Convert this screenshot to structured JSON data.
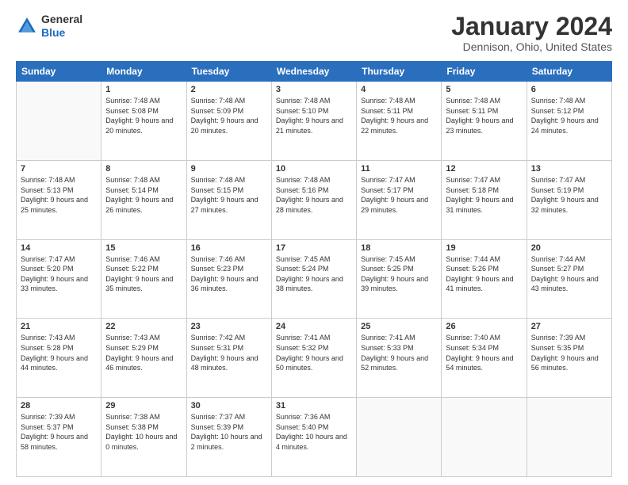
{
  "header": {
    "logo": {
      "line1": "General",
      "line2": "Blue"
    },
    "title": "January 2024",
    "subtitle": "Dennison, Ohio, United States"
  },
  "calendar": {
    "days_of_week": [
      "Sunday",
      "Monday",
      "Tuesday",
      "Wednesday",
      "Thursday",
      "Friday",
      "Saturday"
    ],
    "weeks": [
      [
        {
          "day": "",
          "sunrise": "",
          "sunset": "",
          "daylight": "",
          "empty": true
        },
        {
          "day": "1",
          "sunrise": "Sunrise: 7:48 AM",
          "sunset": "Sunset: 5:08 PM",
          "daylight": "Daylight: 9 hours and 20 minutes."
        },
        {
          "day": "2",
          "sunrise": "Sunrise: 7:48 AM",
          "sunset": "Sunset: 5:09 PM",
          "daylight": "Daylight: 9 hours and 20 minutes."
        },
        {
          "day": "3",
          "sunrise": "Sunrise: 7:48 AM",
          "sunset": "Sunset: 5:10 PM",
          "daylight": "Daylight: 9 hours and 21 minutes."
        },
        {
          "day": "4",
          "sunrise": "Sunrise: 7:48 AM",
          "sunset": "Sunset: 5:11 PM",
          "daylight": "Daylight: 9 hours and 22 minutes."
        },
        {
          "day": "5",
          "sunrise": "Sunrise: 7:48 AM",
          "sunset": "Sunset: 5:11 PM",
          "daylight": "Daylight: 9 hours and 23 minutes."
        },
        {
          "day": "6",
          "sunrise": "Sunrise: 7:48 AM",
          "sunset": "Sunset: 5:12 PM",
          "daylight": "Daylight: 9 hours and 24 minutes."
        }
      ],
      [
        {
          "day": "7",
          "sunrise": "Sunrise: 7:48 AM",
          "sunset": "Sunset: 5:13 PM",
          "daylight": "Daylight: 9 hours and 25 minutes."
        },
        {
          "day": "8",
          "sunrise": "Sunrise: 7:48 AM",
          "sunset": "Sunset: 5:14 PM",
          "daylight": "Daylight: 9 hours and 26 minutes."
        },
        {
          "day": "9",
          "sunrise": "Sunrise: 7:48 AM",
          "sunset": "Sunset: 5:15 PM",
          "daylight": "Daylight: 9 hours and 27 minutes."
        },
        {
          "day": "10",
          "sunrise": "Sunrise: 7:48 AM",
          "sunset": "Sunset: 5:16 PM",
          "daylight": "Daylight: 9 hours and 28 minutes."
        },
        {
          "day": "11",
          "sunrise": "Sunrise: 7:47 AM",
          "sunset": "Sunset: 5:17 PM",
          "daylight": "Daylight: 9 hours and 29 minutes."
        },
        {
          "day": "12",
          "sunrise": "Sunrise: 7:47 AM",
          "sunset": "Sunset: 5:18 PM",
          "daylight": "Daylight: 9 hours and 31 minutes."
        },
        {
          "day": "13",
          "sunrise": "Sunrise: 7:47 AM",
          "sunset": "Sunset: 5:19 PM",
          "daylight": "Daylight: 9 hours and 32 minutes."
        }
      ],
      [
        {
          "day": "14",
          "sunrise": "Sunrise: 7:47 AM",
          "sunset": "Sunset: 5:20 PM",
          "daylight": "Daylight: 9 hours and 33 minutes."
        },
        {
          "day": "15",
          "sunrise": "Sunrise: 7:46 AM",
          "sunset": "Sunset: 5:22 PM",
          "daylight": "Daylight: 9 hours and 35 minutes."
        },
        {
          "day": "16",
          "sunrise": "Sunrise: 7:46 AM",
          "sunset": "Sunset: 5:23 PM",
          "daylight": "Daylight: 9 hours and 36 minutes."
        },
        {
          "day": "17",
          "sunrise": "Sunrise: 7:45 AM",
          "sunset": "Sunset: 5:24 PM",
          "daylight": "Daylight: 9 hours and 38 minutes."
        },
        {
          "day": "18",
          "sunrise": "Sunrise: 7:45 AM",
          "sunset": "Sunset: 5:25 PM",
          "daylight": "Daylight: 9 hours and 39 minutes."
        },
        {
          "day": "19",
          "sunrise": "Sunrise: 7:44 AM",
          "sunset": "Sunset: 5:26 PM",
          "daylight": "Daylight: 9 hours and 41 minutes."
        },
        {
          "day": "20",
          "sunrise": "Sunrise: 7:44 AM",
          "sunset": "Sunset: 5:27 PM",
          "daylight": "Daylight: 9 hours and 43 minutes."
        }
      ],
      [
        {
          "day": "21",
          "sunrise": "Sunrise: 7:43 AM",
          "sunset": "Sunset: 5:28 PM",
          "daylight": "Daylight: 9 hours and 44 minutes."
        },
        {
          "day": "22",
          "sunrise": "Sunrise: 7:43 AM",
          "sunset": "Sunset: 5:29 PM",
          "daylight": "Daylight: 9 hours and 46 minutes."
        },
        {
          "day": "23",
          "sunrise": "Sunrise: 7:42 AM",
          "sunset": "Sunset: 5:31 PM",
          "daylight": "Daylight: 9 hours and 48 minutes."
        },
        {
          "day": "24",
          "sunrise": "Sunrise: 7:41 AM",
          "sunset": "Sunset: 5:32 PM",
          "daylight": "Daylight: 9 hours and 50 minutes."
        },
        {
          "day": "25",
          "sunrise": "Sunrise: 7:41 AM",
          "sunset": "Sunset: 5:33 PM",
          "daylight": "Daylight: 9 hours and 52 minutes."
        },
        {
          "day": "26",
          "sunrise": "Sunrise: 7:40 AM",
          "sunset": "Sunset: 5:34 PM",
          "daylight": "Daylight: 9 hours and 54 minutes."
        },
        {
          "day": "27",
          "sunrise": "Sunrise: 7:39 AM",
          "sunset": "Sunset: 5:35 PM",
          "daylight": "Daylight: 9 hours and 56 minutes."
        }
      ],
      [
        {
          "day": "28",
          "sunrise": "Sunrise: 7:39 AM",
          "sunset": "Sunset: 5:37 PM",
          "daylight": "Daylight: 9 hours and 58 minutes."
        },
        {
          "day": "29",
          "sunrise": "Sunrise: 7:38 AM",
          "sunset": "Sunset: 5:38 PM",
          "daylight": "Daylight: 10 hours and 0 minutes."
        },
        {
          "day": "30",
          "sunrise": "Sunrise: 7:37 AM",
          "sunset": "Sunset: 5:39 PM",
          "daylight": "Daylight: 10 hours and 2 minutes."
        },
        {
          "day": "31",
          "sunrise": "Sunrise: 7:36 AM",
          "sunset": "Sunset: 5:40 PM",
          "daylight": "Daylight: 10 hours and 4 minutes."
        },
        {
          "day": "",
          "sunrise": "",
          "sunset": "",
          "daylight": "",
          "empty": true
        },
        {
          "day": "",
          "sunrise": "",
          "sunset": "",
          "daylight": "",
          "empty": true
        },
        {
          "day": "",
          "sunrise": "",
          "sunset": "",
          "daylight": "",
          "empty": true
        }
      ]
    ]
  }
}
